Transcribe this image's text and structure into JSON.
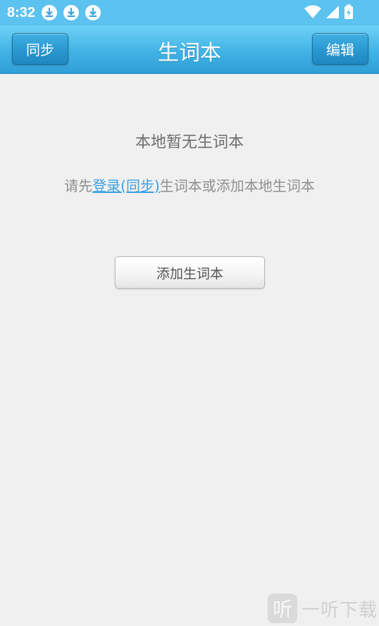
{
  "status_bar": {
    "time": "8:32",
    "notification_icons": [
      "download-icon",
      "download-icon",
      "download-icon"
    ],
    "system_icons": [
      "wifi-icon",
      "signal-icon",
      "battery-charging-icon"
    ],
    "color": "#5cc2ef"
  },
  "titlebar": {
    "title": "生词本",
    "left_button": "同步",
    "right_button": "编辑",
    "color": "#41b3e6"
  },
  "content": {
    "empty_title": "本地暂无生词本",
    "hint_prefix": "请先",
    "hint_link": "登录(同步)",
    "hint_suffix": "生词本或添加本地生词本",
    "add_button": "添加生词本",
    "link_color": "#3b9fe0"
  },
  "watermark": {
    "logo_glyph": "听",
    "text": "一听下载"
  }
}
